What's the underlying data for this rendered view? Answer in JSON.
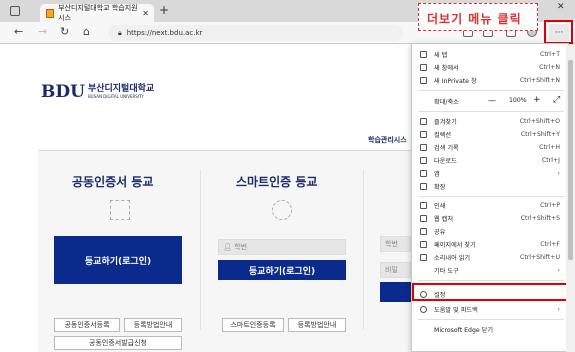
{
  "browser": {
    "tab_title": "부산디지털대학교 학습지원시스",
    "tab_close": "✕",
    "new_tab": "+",
    "url": "https://next.bdu.ac.kr",
    "window_controls": {
      "minimize": "—",
      "close": "✕"
    },
    "more_button": "···"
  },
  "callout": {
    "text": "더보기 메뉴 클릭",
    "color": "#e03030"
  },
  "site": {
    "logo_big": "BDU",
    "logo_kr": "부산디지털대학교",
    "logo_en": "BUSAN DIGITAL UNIVERSITY",
    "sublogo": "학습관리시스",
    "accent": "#0a2a8c",
    "panels": [
      {
        "title": "공동인증서 등교",
        "button": "등교하기(로그인)",
        "link1": "공동인증서등록",
        "link2": "등록방법안내",
        "link3": "공동인증서발급신청"
      },
      {
        "title": "스마트인증 등교",
        "field_placeholder": "학번",
        "button": "등교하기(로그인)",
        "link1": "스마트인증등록",
        "link2": "등록방법안내"
      },
      {
        "field1_placeholder": "학번",
        "field2_placeholder": "비밀"
      }
    ]
  },
  "menu": {
    "items": [
      {
        "label": "새 탭",
        "shortcut": "Ctrl+T",
        "icon": "new-tab-icon"
      },
      {
        "label": "새 창에서",
        "shortcut": "Ctrl+N",
        "icon": "new-window-icon"
      },
      {
        "label": "새 InPrivate 창",
        "shortcut": "Ctrl+Shift+N",
        "icon": "inprivate-icon"
      }
    ],
    "zoom": {
      "label": "확대/축소",
      "minus": "—",
      "value": "100%",
      "plus": "+",
      "fullscreen": "⤢"
    },
    "items2": [
      {
        "label": "즐겨찾기",
        "shortcut": "Ctrl+Shift+O",
        "icon": "star-icon"
      },
      {
        "label": "컬렉션",
        "shortcut": "Ctrl+Shift+Y",
        "icon": "collections-icon"
      },
      {
        "label": "검색 기록",
        "shortcut": "Ctrl+H",
        "icon": "history-icon"
      },
      {
        "label": "다운로드",
        "shortcut": "Ctrl+J",
        "icon": "download-icon"
      },
      {
        "label": "앱",
        "shortcut": "›",
        "icon": "apps-icon"
      },
      {
        "label": "확장",
        "shortcut": "",
        "icon": "extensions-icon"
      }
    ],
    "items3": [
      {
        "label": "인쇄",
        "shortcut": "Ctrl+P",
        "icon": "print-icon"
      },
      {
        "label": "웹 캡처",
        "shortcut": "Ctrl+Shift+S",
        "icon": "capture-icon"
      },
      {
        "label": "공유",
        "shortcut": "",
        "icon": "share-icon"
      },
      {
        "label": "페이지에서 찾기",
        "shortcut": "Ctrl+F",
        "icon": "find-icon"
      },
      {
        "label": "소리내어 읽기",
        "shortcut": "Ctrl+Shift+U",
        "icon": "read-aloud-icon"
      },
      {
        "label": "기타 도구",
        "shortcut": "›",
        "icon": ""
      }
    ],
    "items4": [
      {
        "label": "설정",
        "shortcut": "",
        "icon": "settings-icon"
      },
      {
        "label": "도움말 및 피드백",
        "shortcut": "›",
        "icon": "help-icon"
      },
      {
        "label": "Microsoft Edge 닫기",
        "shortcut": "",
        "icon": ""
      }
    ]
  },
  "highlight_color": "#e00000"
}
